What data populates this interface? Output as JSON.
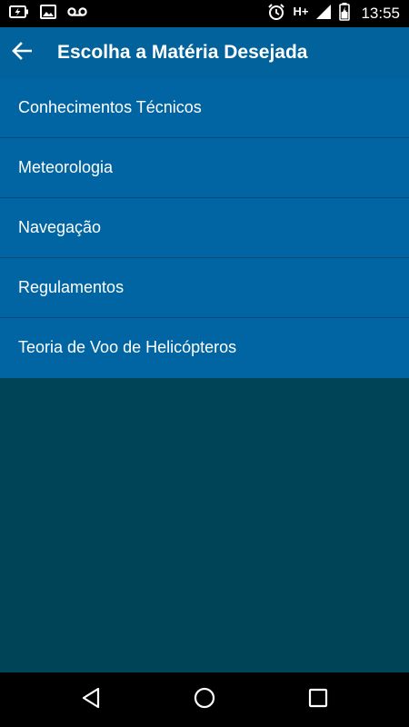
{
  "status_bar": {
    "time": "13:55",
    "network": "H+",
    "icons": [
      "battery-charging-icon",
      "image-icon",
      "voicemail-icon",
      "alarm-icon",
      "signal-icon",
      "battery-icon"
    ]
  },
  "app_bar": {
    "title": "Escolha a Matéria Desejada",
    "back_icon": "arrow-left-icon"
  },
  "subjects": [
    {
      "label": "Conhecimentos Técnicos"
    },
    {
      "label": "Meteorologia"
    },
    {
      "label": "Navegação"
    },
    {
      "label": "Regulamentos"
    },
    {
      "label": "Teoria de Voo de Helicópteros"
    }
  ],
  "nav_bar": {
    "icons": [
      "back-triangle-icon",
      "home-circle-icon",
      "recents-square-icon"
    ]
  },
  "colors": {
    "app_bar": "#02629b",
    "list_background": "#0065a2",
    "screen_background": "#004457",
    "divider": "#0b4a75"
  }
}
